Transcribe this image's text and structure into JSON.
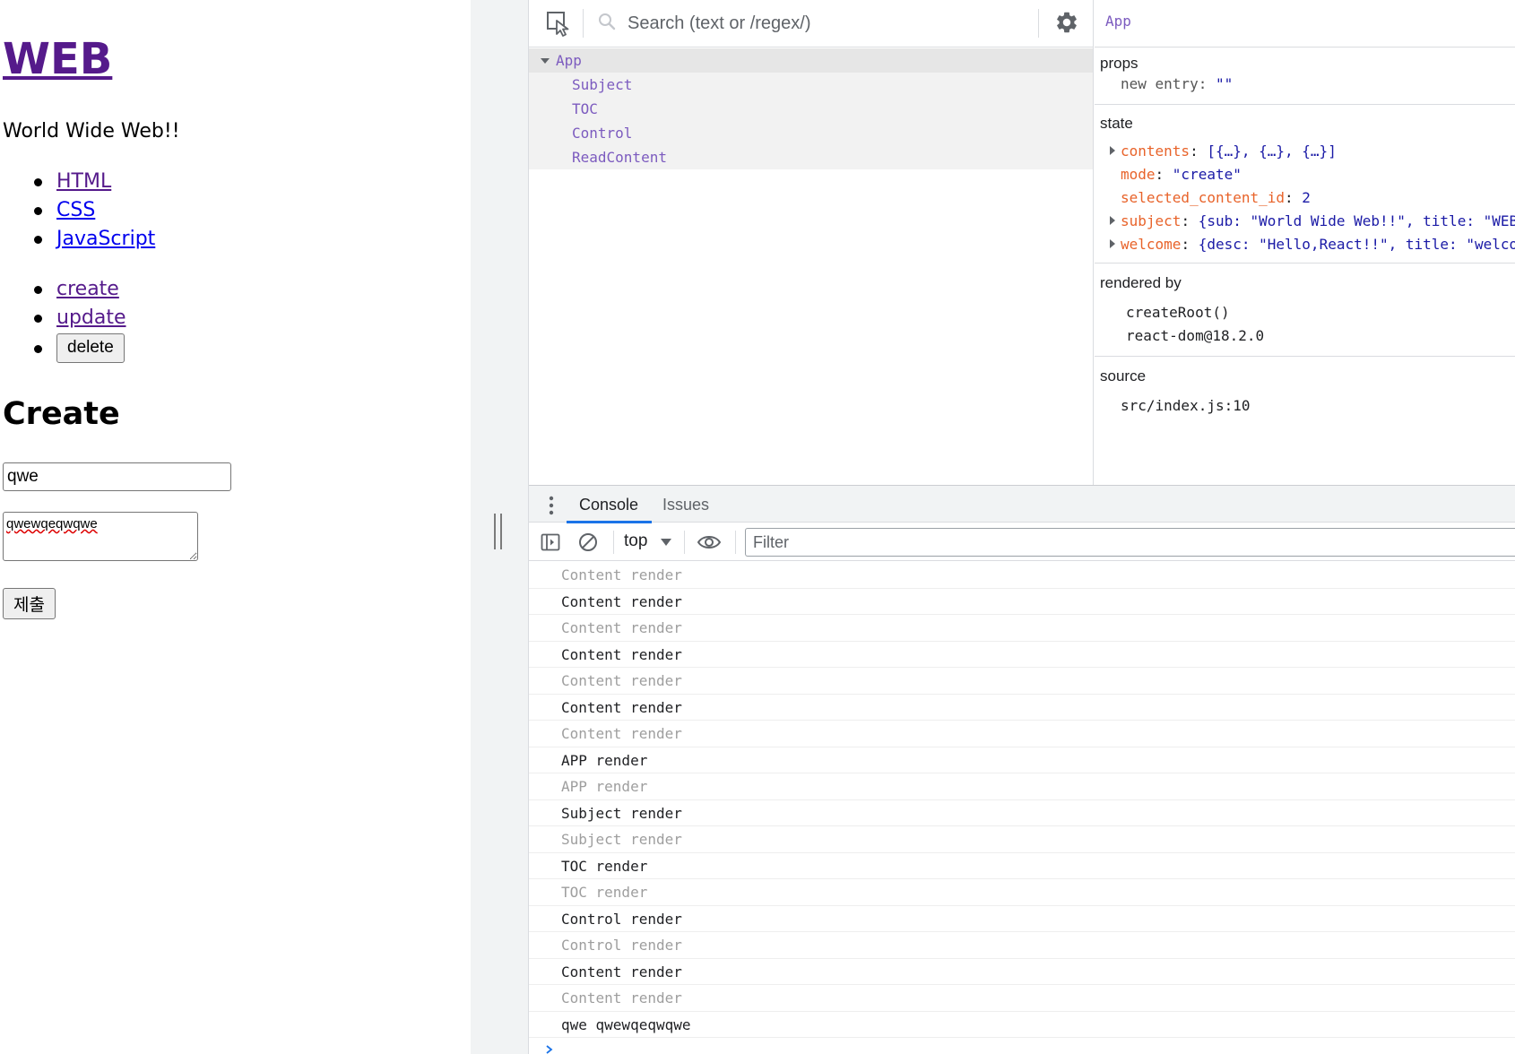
{
  "page": {
    "title": "WEB",
    "subtitle": "World Wide Web!!",
    "toc_items": [
      {
        "label": "HTML",
        "state": "visited"
      },
      {
        "label": "CSS",
        "state": "fresh"
      },
      {
        "label": "JavaScript",
        "state": "fresh"
      }
    ],
    "control": {
      "create": "create",
      "update": "update",
      "delete": "delete"
    },
    "form": {
      "heading": "Create",
      "title_value": "qwe",
      "desc_value": "qwewqeqwqwe",
      "submit_label": "제출"
    }
  },
  "devtools": {
    "components": {
      "search_placeholder": "Search (text or /regex/)",
      "tree": {
        "root": "App",
        "children": [
          "Subject",
          "TOC",
          "Control",
          "ReadContent"
        ]
      }
    },
    "inspector": {
      "selected": "App",
      "props_title": "props",
      "props": [
        {
          "key": "new entry",
          "value": "\"\""
        }
      ],
      "state_title": "state",
      "state": [
        {
          "key": "contents",
          "value": "[{…}, {…}, {…}]",
          "expandable": true
        },
        {
          "key": "mode",
          "value": "\"create\"",
          "expandable": false
        },
        {
          "key": "selected_content_id",
          "value": "2",
          "expandable": false
        },
        {
          "key": "subject",
          "value": "{sub: \"World Wide Web!!\", title: \"WEB\"}",
          "expandable": true
        },
        {
          "key": "welcome",
          "value": "{desc: \"Hello,React!!\", title: \"welcome",
          "expandable": true
        }
      ],
      "rendered_by_title": "rendered by",
      "rendered_by": [
        "createRoot()",
        "react-dom@18.2.0"
      ],
      "source_title": "source",
      "source": "src/index.js:10"
    },
    "drawer": {
      "tabs": [
        "Console",
        "Issues"
      ],
      "active_tab": "Console",
      "context": "top",
      "filter_placeholder": "Filter",
      "logs": [
        {
          "text": "Content render",
          "dim": true
        },
        {
          "text": "Content render",
          "dim": false
        },
        {
          "text": "Content render",
          "dim": true
        },
        {
          "text": "Content render",
          "dim": false
        },
        {
          "text": "Content render",
          "dim": true
        },
        {
          "text": "Content render",
          "dim": false
        },
        {
          "text": "Content render",
          "dim": true
        },
        {
          "text": "APP render",
          "dim": false
        },
        {
          "text": "APP render",
          "dim": true
        },
        {
          "text": "Subject render",
          "dim": false
        },
        {
          "text": "Subject render",
          "dim": true
        },
        {
          "text": "TOC render",
          "dim": false
        },
        {
          "text": "TOC render",
          "dim": true
        },
        {
          "text": "Control render",
          "dim": false
        },
        {
          "text": "Control render",
          "dim": true
        },
        {
          "text": "Content render",
          "dim": false
        },
        {
          "text": "Content render",
          "dim": true
        },
        {
          "text": "qwe qwewqeqwqwe",
          "dim": false
        }
      ]
    },
    "colors": {
      "component_name": "#7c5bbf",
      "state_key": "#e8632a",
      "value": "#1a1aa6",
      "accent": "#1a73e8"
    }
  }
}
